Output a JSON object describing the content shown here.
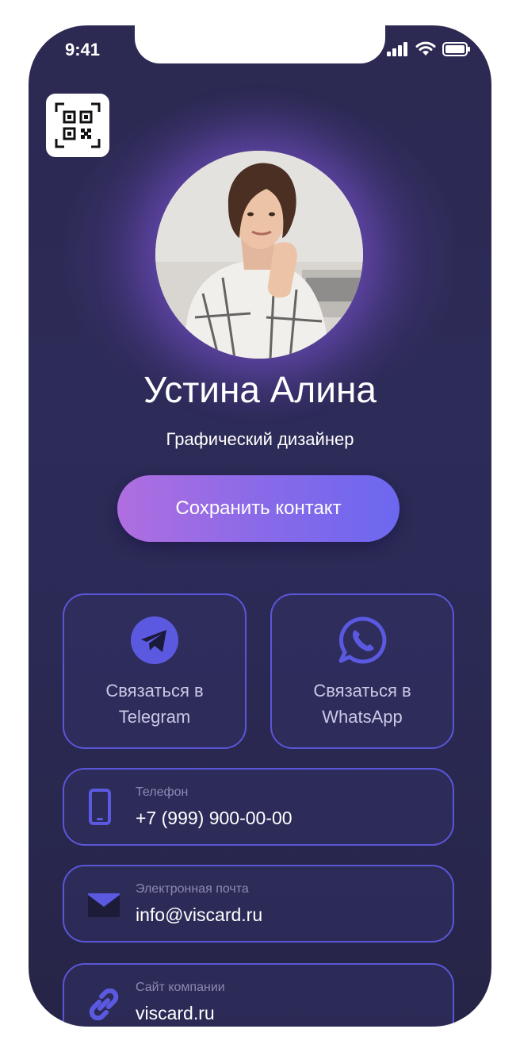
{
  "status_bar": {
    "time": "9:41"
  },
  "profile": {
    "name": "Устина Алина",
    "role": "Графический дизайнер"
  },
  "actions": {
    "save_label": "Сохранить контакт"
  },
  "messengers": [
    {
      "line1": "Связаться в",
      "line2": "Telegram"
    },
    {
      "line1": "Связаться в",
      "line2": "WhatsApp"
    }
  ],
  "contacts": {
    "phone": {
      "label": "Телефон",
      "value": "+7 (999) 900-00-00"
    },
    "email": {
      "label": "Электронная почта",
      "value": "info@viscard.ru"
    },
    "site": {
      "label": "Сайт компании",
      "value": "viscard.ru"
    }
  },
  "colors": {
    "accent": "#5a56d8",
    "background": "#2c2a52",
    "button_start": "#b06ee0",
    "button_end": "#6c67f0"
  }
}
